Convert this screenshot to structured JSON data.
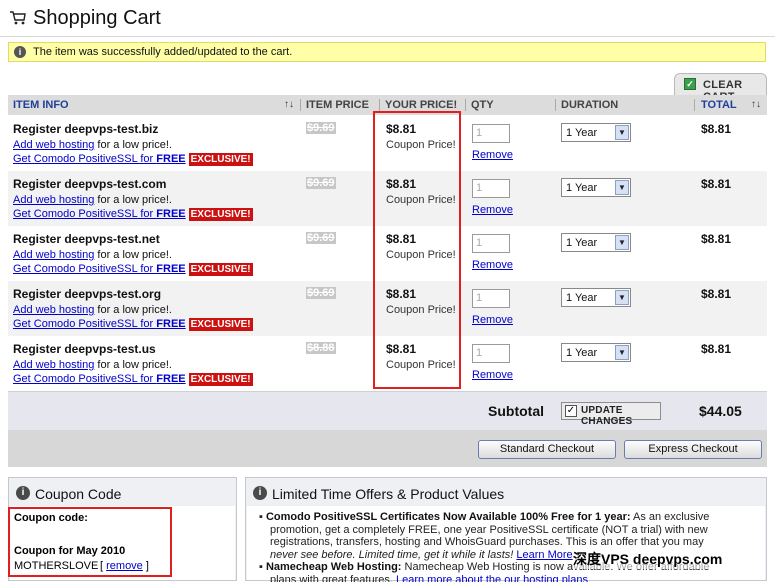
{
  "page": {
    "title": "Shopping Cart"
  },
  "notice": {
    "text": "The item was successfully added/updated to the cart."
  },
  "clear_cart": {
    "label": "CLEAR CART"
  },
  "columns": {
    "item_info": "ITEM INFO",
    "sort_glyph": "↑↓",
    "item_price": "ITEM PRICE",
    "your_price": "YOUR PRICE!",
    "qty": "QTY",
    "duration": "DURATION",
    "total": "TOTAL"
  },
  "items": [
    {
      "name": "Register deepvps-test.biz",
      "old_price": "$9.69",
      "price": "$8.81",
      "note": "Coupon Price!",
      "qty": "1",
      "duration": "1 Year",
      "total": "$8.81"
    },
    {
      "name": "Register deepvps-test.com",
      "old_price": "$9.69",
      "price": "$8.81",
      "note": "Coupon Price!",
      "qty": "1",
      "duration": "1 Year",
      "total": "$8.81"
    },
    {
      "name": "Register deepvps-test.net",
      "old_price": "$9.69",
      "price": "$8.81",
      "note": "Coupon Price!",
      "qty": "1",
      "duration": "1 Year",
      "total": "$8.81"
    },
    {
      "name": "Register deepvps-test.org",
      "old_price": "$9.69",
      "price": "$8.81",
      "note": "Coupon Price!",
      "qty": "1",
      "duration": "1 Year",
      "total": "$8.81"
    },
    {
      "name": "Register deepvps-test.us",
      "old_price": "$8.88",
      "price": "$8.81",
      "note": "Coupon Price!",
      "qty": "1",
      "duration": "1 Year",
      "total": "$8.81"
    }
  ],
  "row_links": {
    "hosting_link": "Add web hosting",
    "hosting_suffix": " for a low price!.",
    "ssl_link": "Get Comodo PositiveSSL for ",
    "ssl_free": "FREE",
    "exclusive": "EXCLUSIVE!",
    "remove": "Remove"
  },
  "subtotal": {
    "label": "Subtotal",
    "update_label": "UPDATE CHANGES",
    "amount": "$44.05"
  },
  "checkout": {
    "standard": "Standard Checkout",
    "express": "Express Checkout"
  },
  "coupon_panel": {
    "title": "Coupon Code",
    "label": "Coupon code:",
    "name": "Coupon for May 2010",
    "code": "MOTHERSLOVE",
    "remove": "remove"
  },
  "offers_panel": {
    "title": "Limited Time Offers & Product Values",
    "offer1_title": "Comodo PositiveSSL Certificates Now Available 100% Free for 1 year:",
    "offer1_line1": " As an exclusive",
    "offer1_line2": "promotion, get a completely FREE, one year PositiveSSL certificate (NOT a trial) with new",
    "offer1_line3": "registrations, transfers, hosting and WhoisGuard purchases. This is an offer that you may",
    "offer1_line4": "never see before. Limited time, get it while it lasts!",
    "offer1_link": "Learn More",
    "offer2_title": "Namecheap Web Hosting:",
    "offer2_line1": " Namecheap Web Hosting is now available. We offer affordable",
    "offer2_line2": "plans with great features.",
    "offer2_link": "Learn more about the our hosting plans"
  },
  "watermark": {
    "text": "深度VPS  deepvps.com"
  },
  "colors": {
    "highlight": "#e02020",
    "link": "#0000cc",
    "exclusive_bg": "#cc1111",
    "notice_bg": "#ffffa8"
  }
}
